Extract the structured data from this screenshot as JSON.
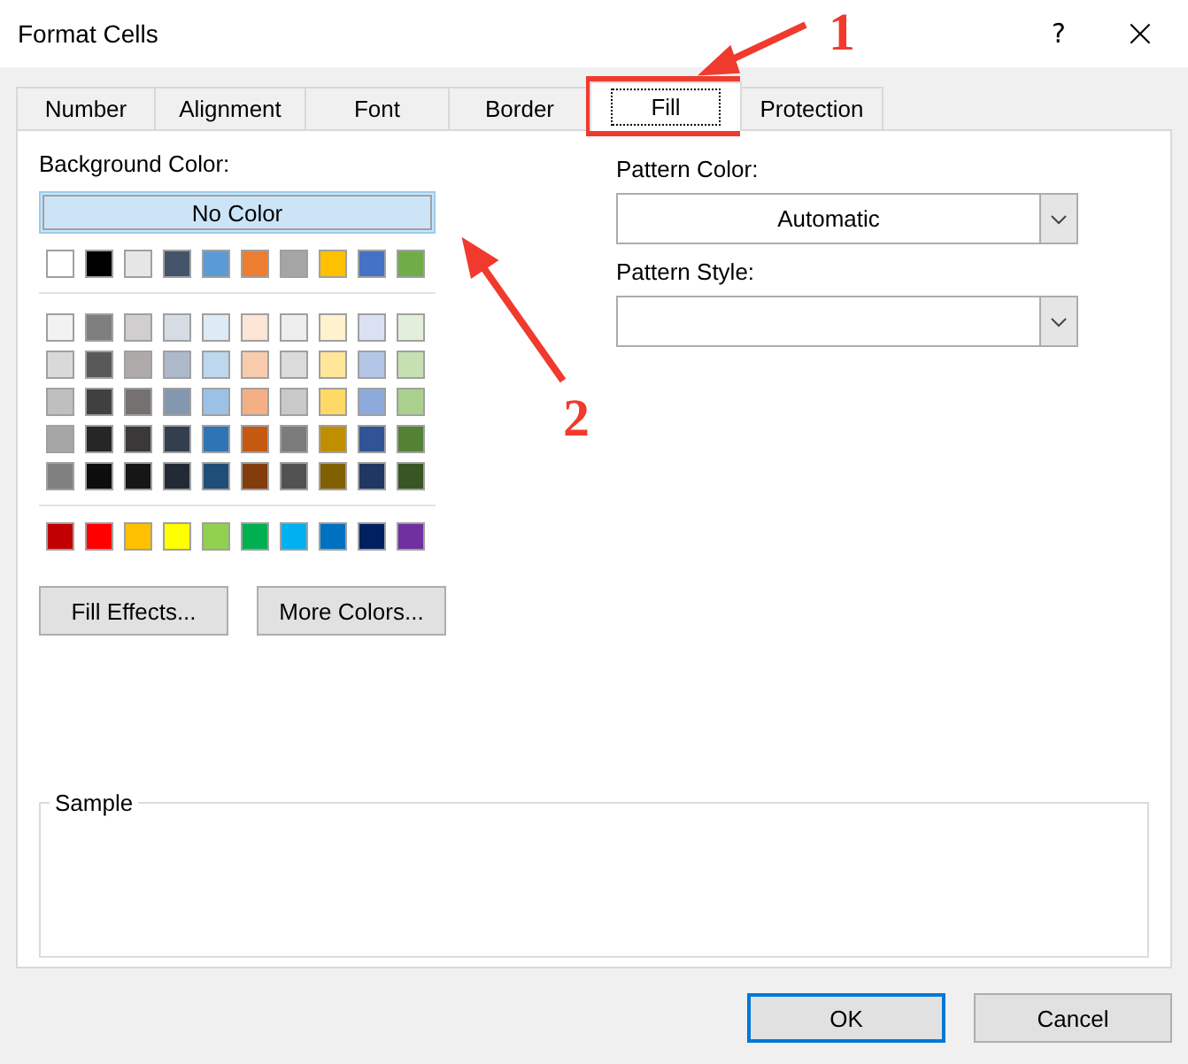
{
  "window": {
    "title": "Format Cells",
    "help": "?",
    "close": "×"
  },
  "tabs": [
    {
      "label": "Number",
      "selected": false
    },
    {
      "label": "Alignment",
      "selected": false
    },
    {
      "label": "Font",
      "selected": false
    },
    {
      "label": "Border",
      "selected": false
    },
    {
      "label": "Fill",
      "selected": true
    },
    {
      "label": "Protection",
      "selected": false
    }
  ],
  "background_color": {
    "label": "Background Color:",
    "no_color": "No Color",
    "theme_colors": [
      {
        "color": "#ffffff"
      },
      {
        "color": "#000000"
      },
      {
        "color": "#e7e6e6"
      },
      {
        "color": "#44546a"
      },
      {
        "color": "#5b9bd5"
      },
      {
        "color": "#ed7d31"
      },
      {
        "color": "#a5a5a5"
      },
      {
        "color": "#ffc000"
      },
      {
        "color": "#4472c4"
      },
      {
        "color": "#70ad47"
      }
    ],
    "tints": [
      {
        "color": "#f2f2f2"
      },
      {
        "color": "#7f7f7f"
      },
      {
        "color": "#d0cece"
      },
      {
        "color": "#d6dce4"
      },
      {
        "color": "#ddebf7"
      },
      {
        "color": "#fce4d6"
      },
      {
        "color": "#ededed"
      },
      {
        "color": "#fff2cc"
      },
      {
        "color": "#d9e1f2"
      },
      {
        "color": "#e2efda"
      },
      {
        "color": "#d9d9d9"
      },
      {
        "color": "#595959"
      },
      {
        "color": "#aeaaaa"
      },
      {
        "color": "#acb9ca"
      },
      {
        "color": "#bdd7ee"
      },
      {
        "color": "#f8cbad"
      },
      {
        "color": "#dbdbdb"
      },
      {
        "color": "#ffe699"
      },
      {
        "color": "#b4c6e7"
      },
      {
        "color": "#c6e0b4"
      },
      {
        "color": "#bfbfbf"
      },
      {
        "color": "#404040"
      },
      {
        "color": "#757171"
      },
      {
        "color": "#8497b0"
      },
      {
        "color": "#9bc2e6"
      },
      {
        "color": "#f4b084"
      },
      {
        "color": "#c9c9c9"
      },
      {
        "color": "#ffd966"
      },
      {
        "color": "#8ea9db"
      },
      {
        "color": "#a9d08e"
      },
      {
        "color": "#a6a6a6"
      },
      {
        "color": "#262626"
      },
      {
        "color": "#3a3838"
      },
      {
        "color": "#333f4f"
      },
      {
        "color": "#2f75b5"
      },
      {
        "color": "#c65911"
      },
      {
        "color": "#7b7b7b"
      },
      {
        "color": "#bf8f00"
      },
      {
        "color": "#305496"
      },
      {
        "color": "#548235"
      },
      {
        "color": "#808080"
      },
      {
        "color": "#0d0d0d"
      },
      {
        "color": "#161616"
      },
      {
        "color": "#222b35"
      },
      {
        "color": "#1f4e78"
      },
      {
        "color": "#833c0c"
      },
      {
        "color": "#525252"
      },
      {
        "color": "#806000"
      },
      {
        "color": "#203764"
      },
      {
        "color": "#375623"
      }
    ],
    "standard_colors": [
      {
        "color": "#c00000"
      },
      {
        "color": "#ff0000"
      },
      {
        "color": "#ffc000"
      },
      {
        "color": "#ffff00"
      },
      {
        "color": "#92d050"
      },
      {
        "color": "#00b050"
      },
      {
        "color": "#00b0f0"
      },
      {
        "color": "#0070c0"
      },
      {
        "color": "#002060"
      },
      {
        "color": "#7030a0"
      }
    ],
    "buttons": [
      "Fill Effects...",
      "More Colors..."
    ]
  },
  "pattern_color": {
    "label": "Pattern Color:",
    "value": "Automatic"
  },
  "pattern_style": {
    "label": "Pattern Style:"
  },
  "sample": {
    "label": "Sample"
  },
  "footer_buttons": [
    "OK",
    "Cancel"
  ],
  "annotations": [
    {
      "label": "1"
    },
    {
      "label": "2"
    }
  ]
}
